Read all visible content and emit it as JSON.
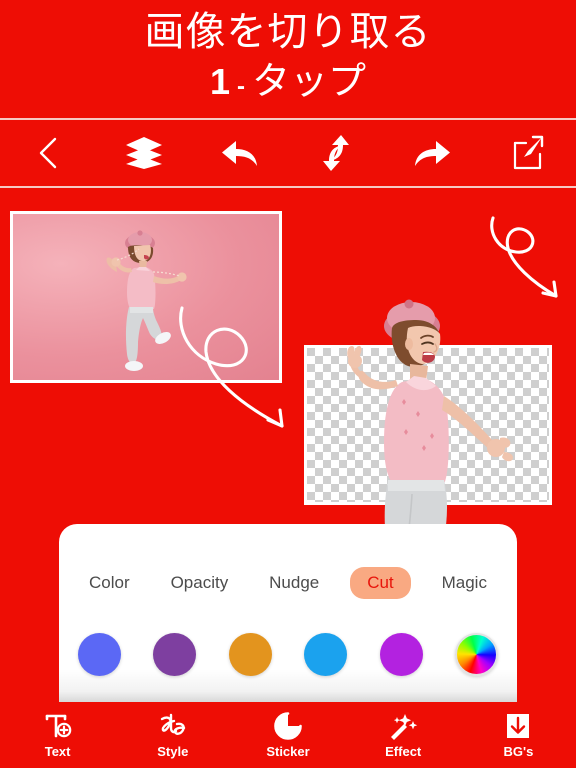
{
  "theme": {
    "brand_red": "#ee0d05",
    "panel_white": "#ffffff",
    "active_pill": "#f9a982",
    "active_text": "#e8150b",
    "divider": "#f6c8c4"
  },
  "header": {
    "line1": "画像を切り取る",
    "number": "1",
    "dash": "-",
    "line2_word": "タップ"
  },
  "toolbar": {
    "items": [
      {
        "name": "back-icon",
        "label": "Back"
      },
      {
        "name": "layers-icon",
        "label": "Layers"
      },
      {
        "name": "undo-icon",
        "label": "Undo"
      },
      {
        "name": "swap-icon",
        "label": "Swap"
      },
      {
        "name": "redo-icon",
        "label": "Redo"
      },
      {
        "name": "share-icon",
        "label": "Share"
      }
    ]
  },
  "canvas": {
    "original_photo": {
      "alt": "Woman jumping on pink background",
      "background": "#eb919d"
    },
    "cutout_photo": {
      "alt": "Woman cut out with transparent checkerboard background",
      "background": "transparent-checkerboard"
    },
    "doodles": [
      {
        "name": "curly-arrow-large",
        "direction": "down-right"
      },
      {
        "name": "curly-arrow-small",
        "direction": "down-right"
      }
    ]
  },
  "options_panel": {
    "tabs": [
      {
        "label": "Color",
        "active": false
      },
      {
        "label": "Opacity",
        "active": false
      },
      {
        "label": "Nudge",
        "active": false
      },
      {
        "label": "Cut",
        "active": true
      },
      {
        "label": "Magic",
        "active": false
      }
    ],
    "swatches": [
      {
        "name": "swatch-blue-violet",
        "color": "#5b68f5",
        "type": "solid"
      },
      {
        "name": "swatch-purple",
        "color": "#7e3fa0",
        "type": "solid"
      },
      {
        "name": "swatch-orange",
        "color": "#e3941e",
        "type": "solid"
      },
      {
        "name": "swatch-sky-blue",
        "color": "#1ba2ee",
        "type": "solid"
      },
      {
        "name": "swatch-magenta",
        "color": "#b322e0",
        "type": "solid"
      },
      {
        "name": "swatch-color-wheel",
        "color": "rainbow",
        "type": "wheel"
      }
    ]
  },
  "bottom_nav": {
    "items": [
      {
        "label": "Text",
        "icon": "text-add-icon"
      },
      {
        "label": "Style",
        "icon": "style-script-icon"
      },
      {
        "label": "Sticker",
        "icon": "sticker-icon"
      },
      {
        "label": "Effect",
        "icon": "effect-sparkle-icon"
      },
      {
        "label": "BG's",
        "icon": "background-download-icon"
      }
    ]
  }
}
